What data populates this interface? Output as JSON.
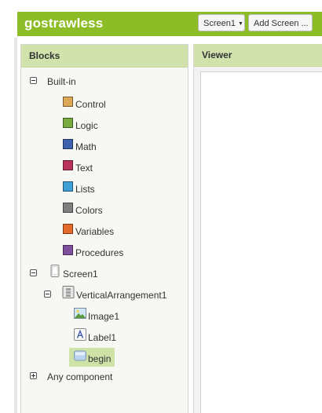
{
  "app": {
    "title": "gostrawless"
  },
  "toolbar": {
    "screen_selector": "Screen1",
    "add_screen": "Add Screen ..."
  },
  "blocks_panel": {
    "title": "Blocks",
    "builtin_label": "Built-in",
    "builtin_items": [
      {
        "label": "Control",
        "color": "#dca858"
      },
      {
        "label": "Logic",
        "color": "#77aa40"
      },
      {
        "label": "Math",
        "color": "#3e62ad"
      },
      {
        "label": "Text",
        "color": "#b8325c"
      },
      {
        "label": "Lists",
        "color": "#3ea1d6"
      },
      {
        "label": "Colors",
        "color": "#7f7f7f"
      },
      {
        "label": "Variables",
        "color": "#e26b2c"
      },
      {
        "label": "Procedures",
        "color": "#7e4f9c"
      }
    ],
    "components": {
      "screen": "Screen1",
      "arrangement": "VerticalArrangement1",
      "children": [
        "Image1",
        "Label1",
        "begin"
      ],
      "selected": "begin"
    },
    "any_component": "Any component"
  },
  "viewer_panel": {
    "title": "Viewer"
  },
  "colors": {
    "accent": "#8dbd26",
    "header_bg": "#d1e2ad",
    "selected_bg": "#cfe2a8"
  }
}
